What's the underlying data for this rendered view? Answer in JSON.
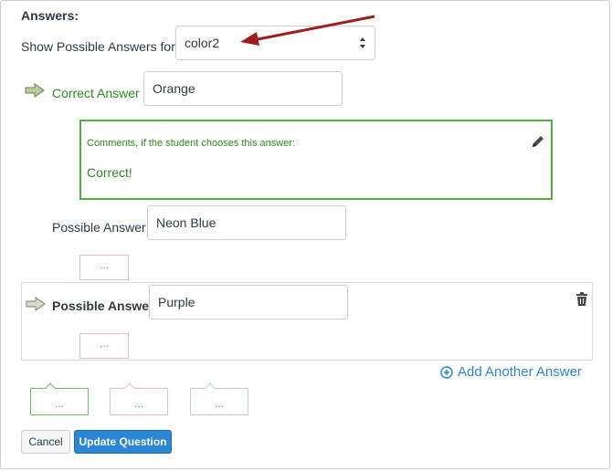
{
  "answers": {
    "section_title": "Answers:",
    "show_label": "Show Possible Answers for",
    "selected_variable": "color2"
  },
  "correct": {
    "label": "Correct Answer",
    "value": "Orange",
    "comment_header": "Comments, if the student chooses this answer:",
    "comment_text": "Correct!"
  },
  "possible": [
    {
      "label": "Possible Answer",
      "value": "Neon Blue",
      "comment_placeholder": "..."
    },
    {
      "label": "Possible Answer",
      "value": "Purple",
      "comment_placeholder": "..."
    }
  ],
  "add_answer_label": "Add Another Answer",
  "general_comments": [
    "...",
    "...",
    "..."
  ],
  "buttons": {
    "cancel": "Cancel",
    "update": "Update Question"
  },
  "colors": {
    "correct_green": "#4db33d",
    "link_blue": "#2b86d4",
    "arrow_red": "#a11d1d"
  }
}
